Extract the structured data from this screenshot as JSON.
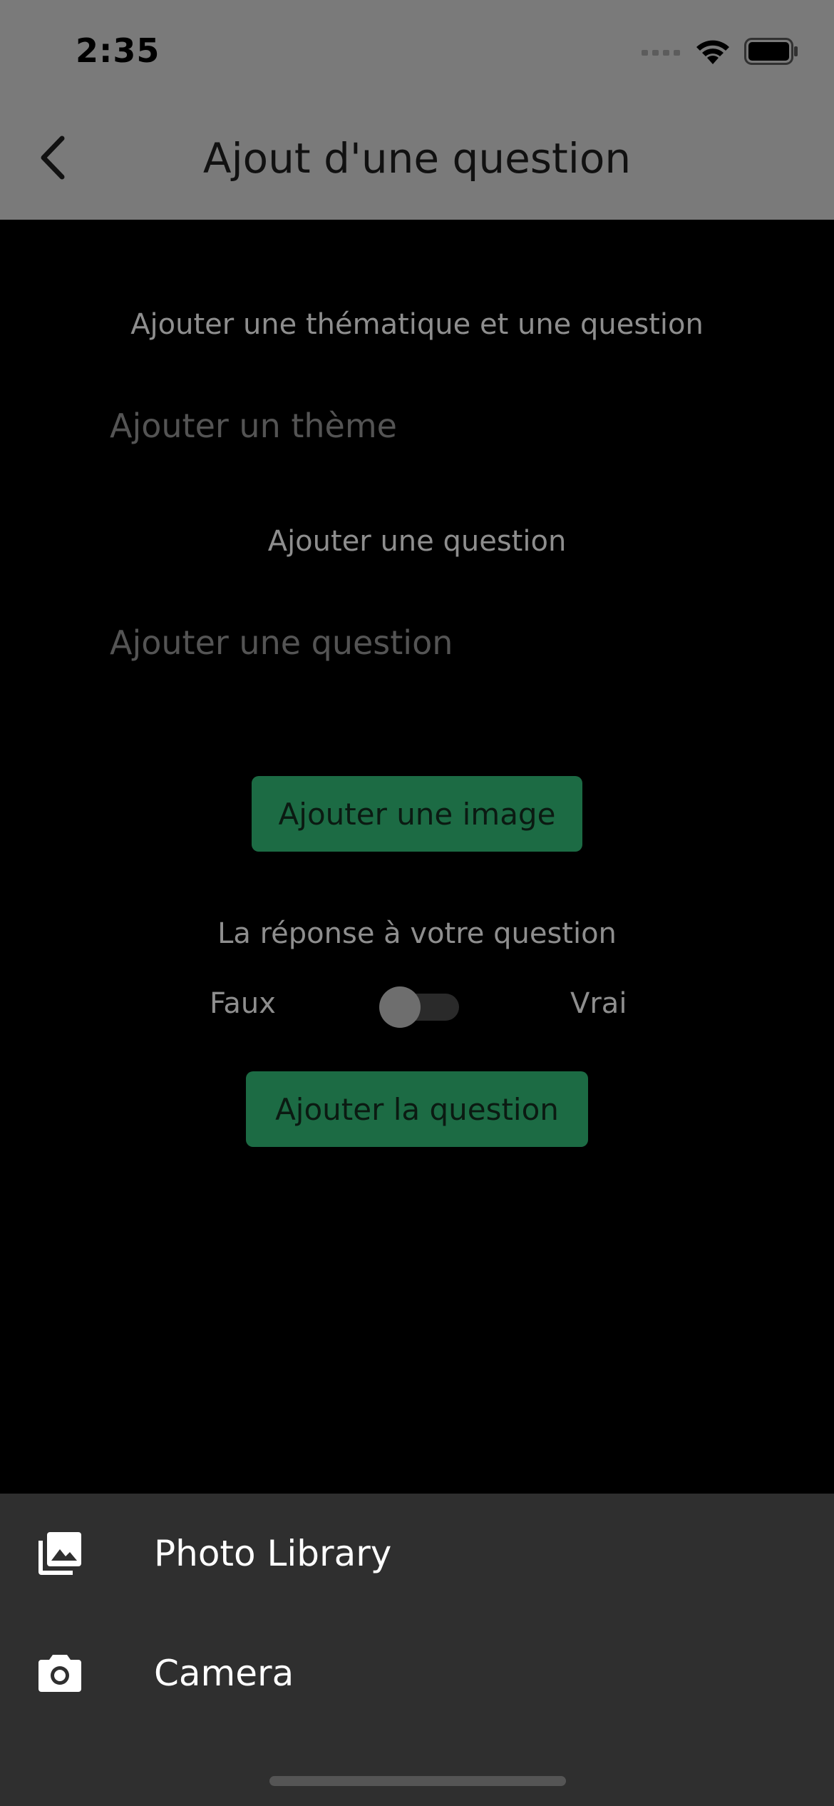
{
  "status_bar": {
    "time": "2:35",
    "signal_icon": "cellular-signal-icon",
    "wifi_icon": "wifi-icon",
    "battery_icon": "battery-icon"
  },
  "app_bar": {
    "title": "Ajout d'une question",
    "back_icon": "chevron-left-icon"
  },
  "form": {
    "theme_section_label": "Ajouter une thématique et une question",
    "theme_placeholder": "Ajouter un thème",
    "question_section_label": "Ajouter une question",
    "question_placeholder": "Ajouter une question",
    "add_image_button": "Ajouter une image",
    "answer_label": "La réponse à votre question",
    "toggle_false_label": "Faux",
    "toggle_true_label": "Vrai",
    "toggle_value": "Faux",
    "submit_button": "Ajouter la question"
  },
  "bottom_sheet": {
    "items": [
      {
        "label": "Photo Library",
        "icon": "photo-library-icon"
      },
      {
        "label": "Camera",
        "icon": "camera-icon"
      }
    ]
  },
  "colors": {
    "button_bg": "#1c6b44",
    "sheet_bg": "#2f2f2f",
    "appbar_bg": "#7a7a7a",
    "background": "#000000"
  }
}
